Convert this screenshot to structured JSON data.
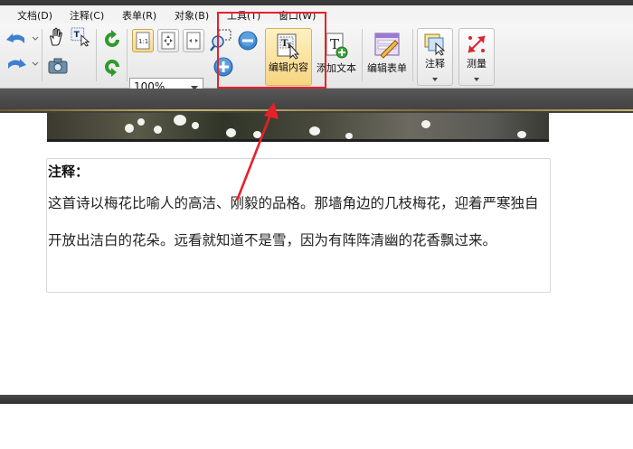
{
  "menubar": {
    "items": [
      "文档(D)",
      "注释(C)",
      "表单(R)",
      "对象(B)",
      "工具(T)",
      "窗口(W)"
    ]
  },
  "toolbar": {
    "zoom_value": "100%",
    "edit_content_label": "编辑内容",
    "add_text_label": "添加文本",
    "edit_form_label": "编辑表单",
    "annotate_label": "注释",
    "measure_label": "测量",
    "actual_size_label": "1:1"
  },
  "document": {
    "note_title": "注释：",
    "note_body": "这首诗以梅花比喻人的高洁、刚毅的品格。那墙角边的几枝梅花，迎着严寒独自开放出洁白的花朵。远看就知道不是雪，因为有阵阵清幽的花香飘过来。"
  },
  "colors": {
    "highlight": "#e8202a",
    "edit_active_bg": "#fbe3a2",
    "rotate_green": "#2e9a2e",
    "undo_blue": "#3f7fd0"
  }
}
